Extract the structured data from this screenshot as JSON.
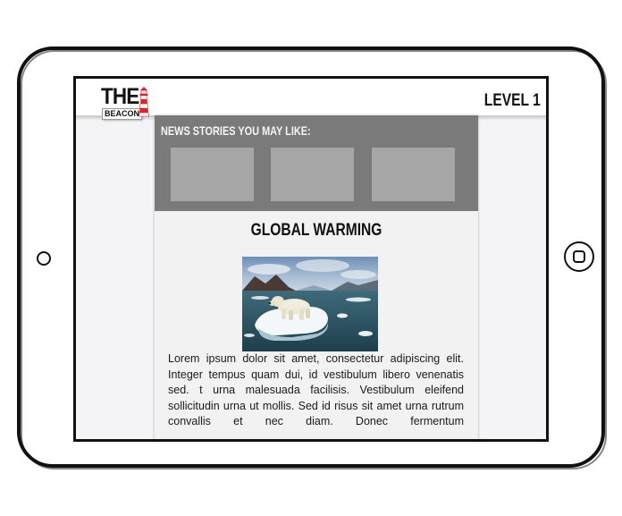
{
  "app": {
    "logo_top": "THE",
    "logo_bottom": "BEACON"
  },
  "header": {
    "level_label": "LEVEL 1"
  },
  "recommendations": {
    "title": "NEWS STORIES YOU MAY LIKE:",
    "stories": [
      "",
      "",
      ""
    ]
  },
  "article": {
    "title": "GLOBAL WARMING",
    "image_icon": "polar-bear-on-ice-photo",
    "body": "Lorem ipsum dolor sit amet, consectetur adipiscing elit. Integer tempus quam dui, id vestibulum libero venenatis sed. t urna malesuada facilisis. Vestibulum eleifend sollicitudin urna ut mollis. Sed id risus sit amet urna rutrum convallis et nec diam. Donec fermentum"
  },
  "colors": {
    "recommend_panel": "#7a7a7a",
    "thumbnail_placeholder": "#a6a6a6",
    "lighthouse_red": "#d9262c"
  }
}
